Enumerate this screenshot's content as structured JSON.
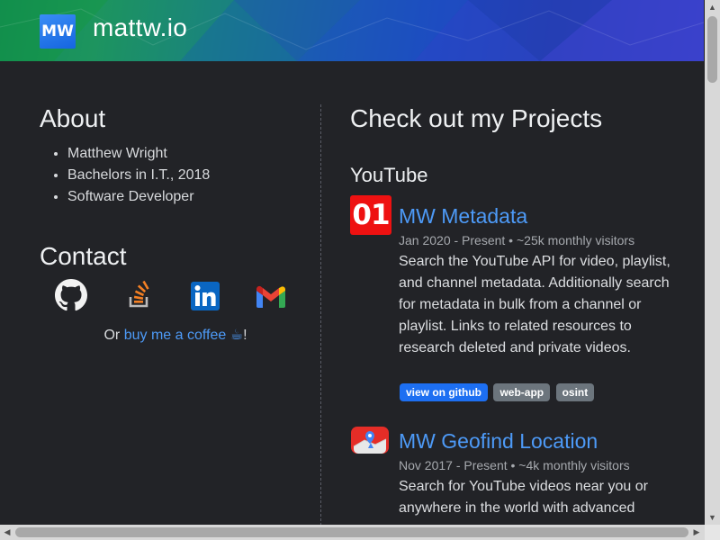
{
  "header": {
    "logo_text": "MW",
    "site_title": "mattw.io"
  },
  "about": {
    "title": "About",
    "items": [
      "Matthew Wright",
      "Bachelors in I.T., 2018",
      "Software Developer"
    ]
  },
  "contact": {
    "title": "Contact",
    "icons": [
      "github-icon",
      "stackoverflow-icon",
      "linkedin-icon",
      "gmail-icon"
    ],
    "coffee_prefix": "Or ",
    "coffee_link": "buy me a coffee",
    "coffee_icon": "☕",
    "coffee_suffix": "!"
  },
  "projects": {
    "title": "Check out my Projects",
    "category": "YouTube",
    "items": [
      {
        "icon_text": "01",
        "title": "MW Metadata",
        "meta": "Jan 2020 - Present • ~25k monthly visitors",
        "description": "Search the YouTube API for video, playlist, and channel metadata. Additionally search for metadata in bulk from a channel or playlist. Links to related resources to research deleted and private videos.",
        "tags": [
          "view on github",
          "web-app",
          "osint"
        ]
      },
      {
        "icon": "map-pin-icon",
        "title": "MW Geofind Location",
        "meta": "Nov 2017 - Present • ~4k monthly visitors",
        "description": "Search for YouTube videos near you or anywhere in the world with advanced"
      }
    ]
  },
  "colors": {
    "background": "#222327",
    "link": "#4d9af7",
    "tag_primary": "#1d6ff2",
    "tag_secondary": "#6c757d",
    "icon_red": "#ee1111"
  }
}
